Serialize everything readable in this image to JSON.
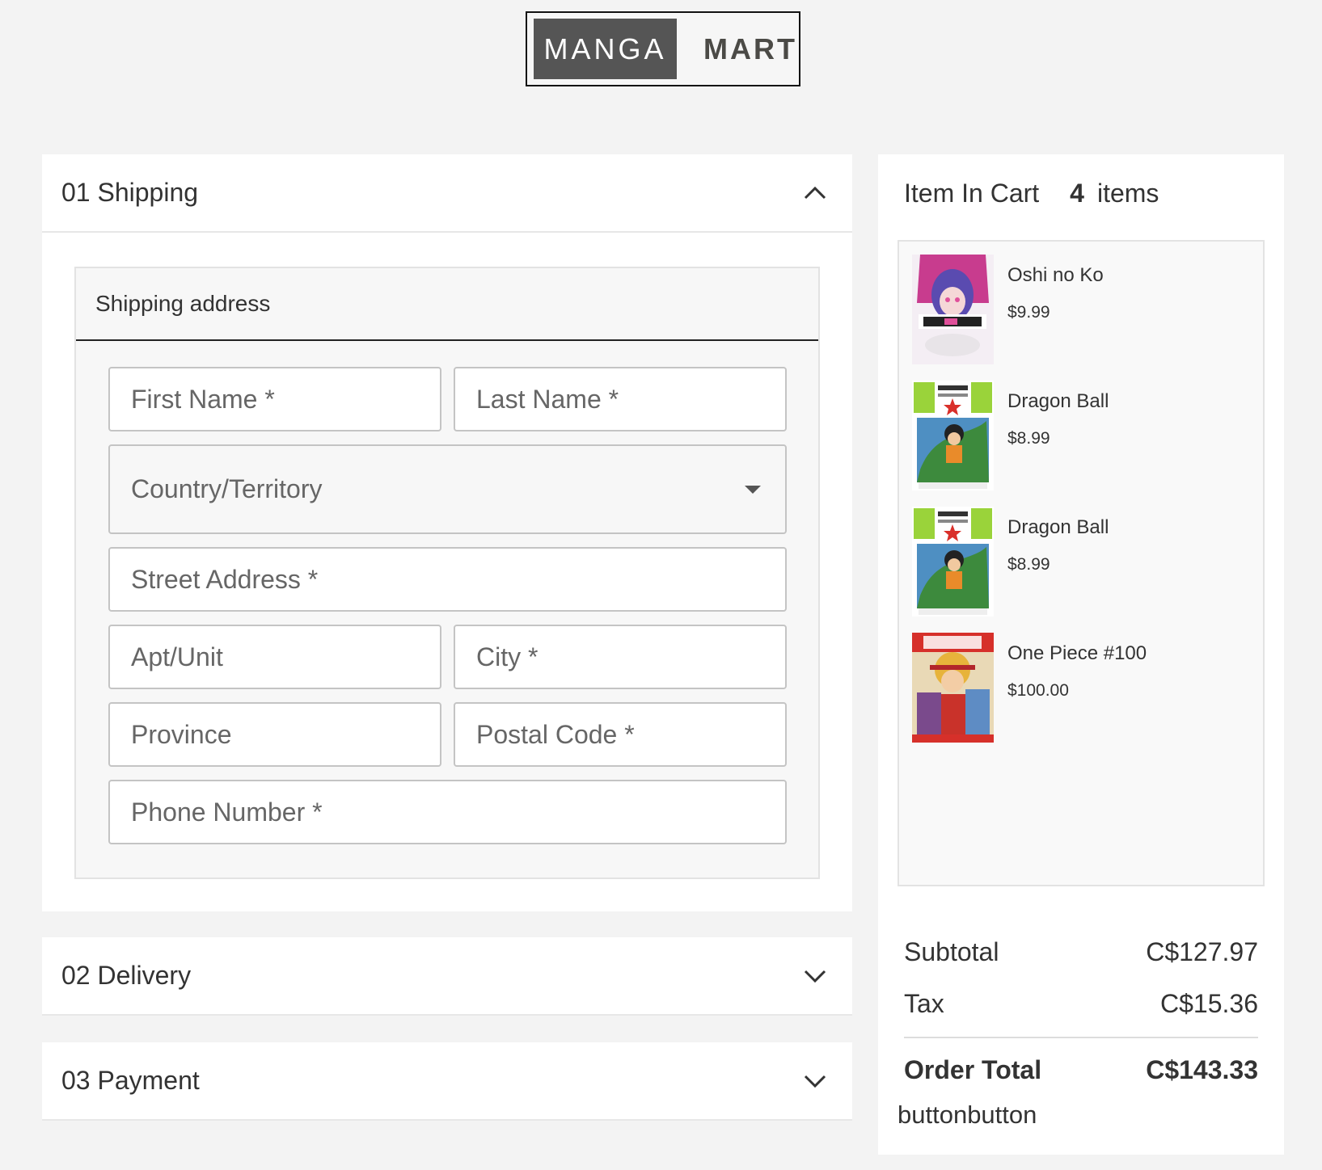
{
  "brand": {
    "left": "MANGA",
    "right": "MART"
  },
  "sections": {
    "shipping": {
      "title": "01 Shipping"
    },
    "delivery": {
      "title": "02 Delivery"
    },
    "payment": {
      "title": "03 Payment"
    }
  },
  "address": {
    "title": "Shipping address",
    "first_name": "First Name *",
    "last_name": "Last Name *",
    "country": "Country/Territory",
    "street": "Street Address *",
    "apt": "Apt/Unit",
    "city": "City *",
    "province": "Province",
    "postal": "Postal Code *",
    "phone": "Phone Number *"
  },
  "cart": {
    "title": "Item In Cart",
    "count": "4",
    "count_label": "items",
    "items": [
      {
        "name": "Oshi no Ko",
        "price": "$9.99"
      },
      {
        "name": "Dragon Ball",
        "price": "$8.99"
      },
      {
        "name": "Dragon Ball",
        "price": "$8.99"
      },
      {
        "name": "One Piece #100",
        "price": "$100.00"
      }
    ]
  },
  "totals": {
    "subtotal_label": "Subtotal",
    "subtotal": "C$127.97",
    "tax_label": "Tax",
    "tax": "C$15.36",
    "total_label": "Order Total",
    "total": "C$143.33"
  },
  "buttons_text": "buttonbutton",
  "icons": {
    "expanded": "chevron-up-icon",
    "collapsed": "chevron-down-icon",
    "select": "caret-down-icon"
  }
}
